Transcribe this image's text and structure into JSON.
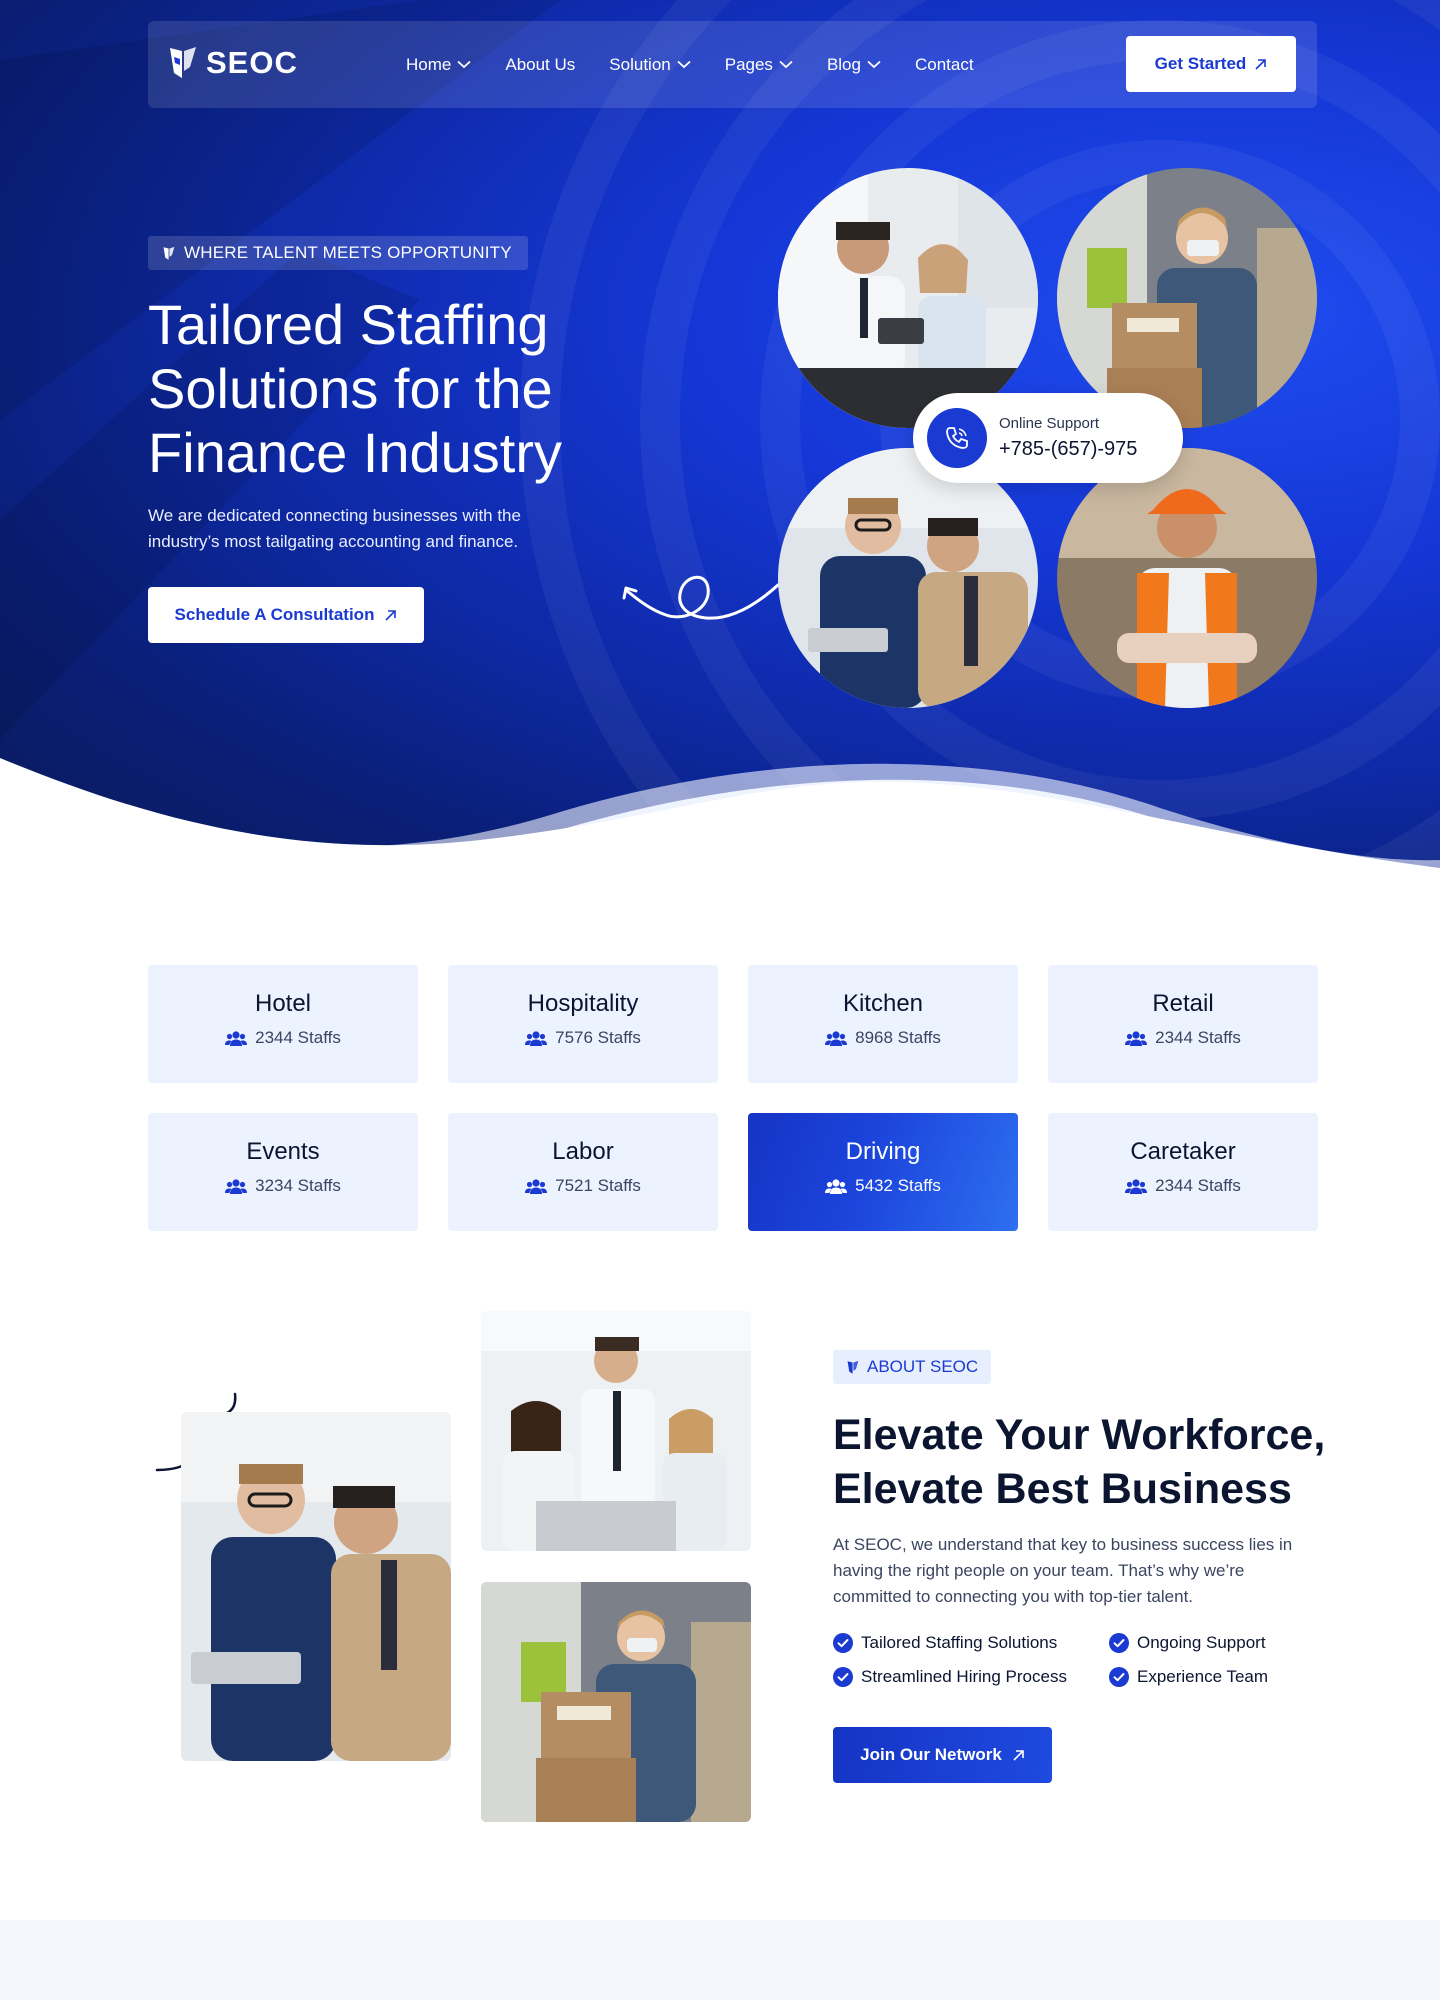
{
  "brand": {
    "name": "SEOC"
  },
  "nav": {
    "items": [
      {
        "label": "Home",
        "has_dropdown": true
      },
      {
        "label": "About Us",
        "has_dropdown": false
      },
      {
        "label": "Solution",
        "has_dropdown": true
      },
      {
        "label": "Pages",
        "has_dropdown": true
      },
      {
        "label": "Blog",
        "has_dropdown": true
      },
      {
        "label": "Contact",
        "has_dropdown": false
      }
    ],
    "cta_label": "Get Started"
  },
  "hero": {
    "tag": "WHERE TALENT MEETS OPPORTUNITY",
    "title": "Tailored Staffing Solutions for the Finance Industry",
    "description": "We are dedicated connecting businesses with the industry’s most tailgating accounting and finance.",
    "cta_label": "Schedule A Consultation",
    "support": {
      "label": "Online Support",
      "phone": "+785-(657)-975"
    }
  },
  "categories": [
    {
      "title": "Hotel",
      "count": "2344 Staffs",
      "active": false
    },
    {
      "title": "Hospitality",
      "count": "7576 Staffs",
      "active": false
    },
    {
      "title": "Kitchen",
      "count": "8968 Staffs",
      "active": false
    },
    {
      "title": "Retail",
      "count": "2344 Staffs",
      "active": false
    },
    {
      "title": "Events",
      "count": "3234 Staffs",
      "active": false
    },
    {
      "title": "Labor",
      "count": "7521 Staffs",
      "active": false
    },
    {
      "title": "Driving",
      "count": "5432 Staffs",
      "active": true
    },
    {
      "title": "Caretaker",
      "count": "2344 Staffs",
      "active": false
    }
  ],
  "about": {
    "tag": "ABOUT SEOC",
    "title": "Elevate Your Workforce, Elevate Best Business",
    "description": "At SEOC, we understand that key to business success lies in having the right people on your team. That’s why we’re committed to connecting you with top-tier talent.",
    "features": [
      "Tailored Staffing Solutions",
      "Ongoing Support",
      "Streamlined Hiring Process",
      "Experience Team"
    ],
    "cta_label": "Join Our Network"
  },
  "colors": {
    "primary": "#1a3ad1",
    "hero_dark": "#0b1a55",
    "card_bg": "#ecf3ff",
    "white": "#ffffff"
  },
  "icons": {
    "logo": "seoc-logo-icon",
    "dropdown": "chevron-down-icon",
    "cta_arrow": "arrow-up-right-icon",
    "phone": "phone-icon",
    "staff": "people-icon",
    "check": "check-circle-icon"
  }
}
